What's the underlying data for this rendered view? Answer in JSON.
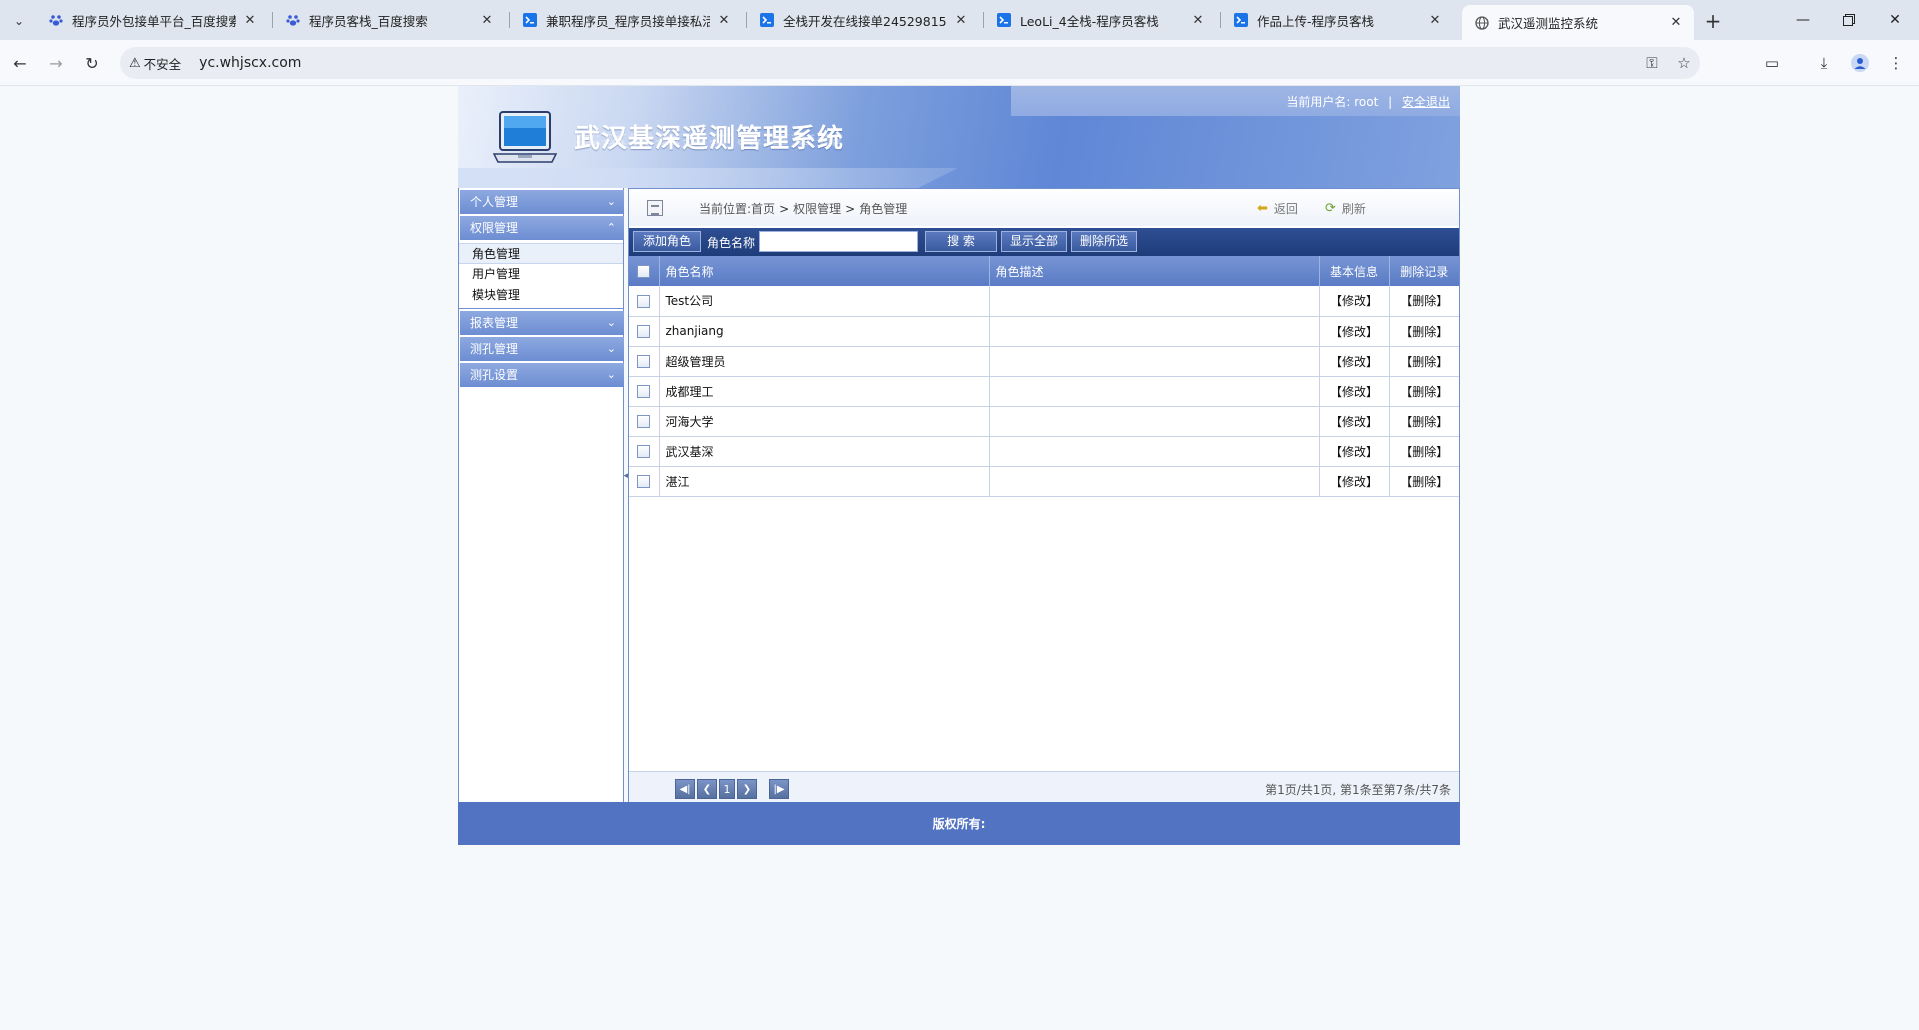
{
  "browser": {
    "tabs": [
      {
        "title": "程序员外包接单平台_百度搜索",
        "icon": "baidu-paw-icon",
        "active": false
      },
      {
        "title": "程序员客栈_百度搜索",
        "icon": "baidu-paw-icon",
        "active": false
      },
      {
        "title": "兼职程序员_程序员接单接私活",
        "icon": "proginn-icon",
        "active": false
      },
      {
        "title": "全栈开发在线接单24529815158",
        "icon": "proginn-icon",
        "active": false
      },
      {
        "title": "LeoLi_4全栈-程序员客栈",
        "icon": "proginn-icon",
        "active": false
      },
      {
        "title": "作品上传-程序员客栈",
        "icon": "proginn-icon",
        "active": false
      },
      {
        "title": "武汉遥测监控系统",
        "icon": "globe-icon",
        "active": true
      }
    ],
    "security_label": "不安全",
    "url": "yc.whjscx.com"
  },
  "header": {
    "system_title": "武汉基深遥测管理系统",
    "user_label": "当前用户名: root",
    "separator": "|",
    "logout": "安全退出"
  },
  "sidebar": {
    "menus": [
      {
        "label": "个人管理",
        "expanded": false,
        "items": []
      },
      {
        "label": "权限管理",
        "expanded": true,
        "items": [
          "角色管理",
          "用户管理",
          "模块管理"
        ]
      },
      {
        "label": "报表管理",
        "expanded": false,
        "items": []
      },
      {
        "label": "测孔管理",
        "expanded": false,
        "items": []
      },
      {
        "label": "测孔设置",
        "expanded": false,
        "items": []
      }
    ]
  },
  "breadcrumb": {
    "prefix": "当前位置:",
    "home": "首页",
    "sep": ">",
    "level1": "权限管理",
    "level2": "角色管理",
    "back": "返回",
    "refresh": "刷新"
  },
  "toolbar": {
    "add_role": "添加角色",
    "role_name_label": "角色名称",
    "role_name_value": "",
    "search": "搜  索",
    "show_all": "显示全部",
    "delete_selected": "删除所选"
  },
  "table": {
    "headers": [
      "角色名称",
      "角色描述",
      "基本信息",
      "删除记录"
    ],
    "edit_label": "【修改】",
    "delete_label": "【删除】",
    "rows": [
      {
        "name": "Test公司",
        "desc": ""
      },
      {
        "name": "zhanjiang",
        "desc": ""
      },
      {
        "name": "超级管理员",
        "desc": ""
      },
      {
        "name": "成都理工",
        "desc": ""
      },
      {
        "name": "河海大学",
        "desc": ""
      },
      {
        "name": "武汉基深",
        "desc": ""
      },
      {
        "name": "湛江",
        "desc": ""
      }
    ]
  },
  "pager": {
    "current_page": "1",
    "info": "第1页/共1页, 第1条至第7条/共7条"
  },
  "footer": {
    "copyright": "版权所有:"
  },
  "colors": {
    "header_blue": "#5f87d6",
    "toolbar_navy": "#1f3c7a",
    "footer_blue": "#5272c2"
  }
}
